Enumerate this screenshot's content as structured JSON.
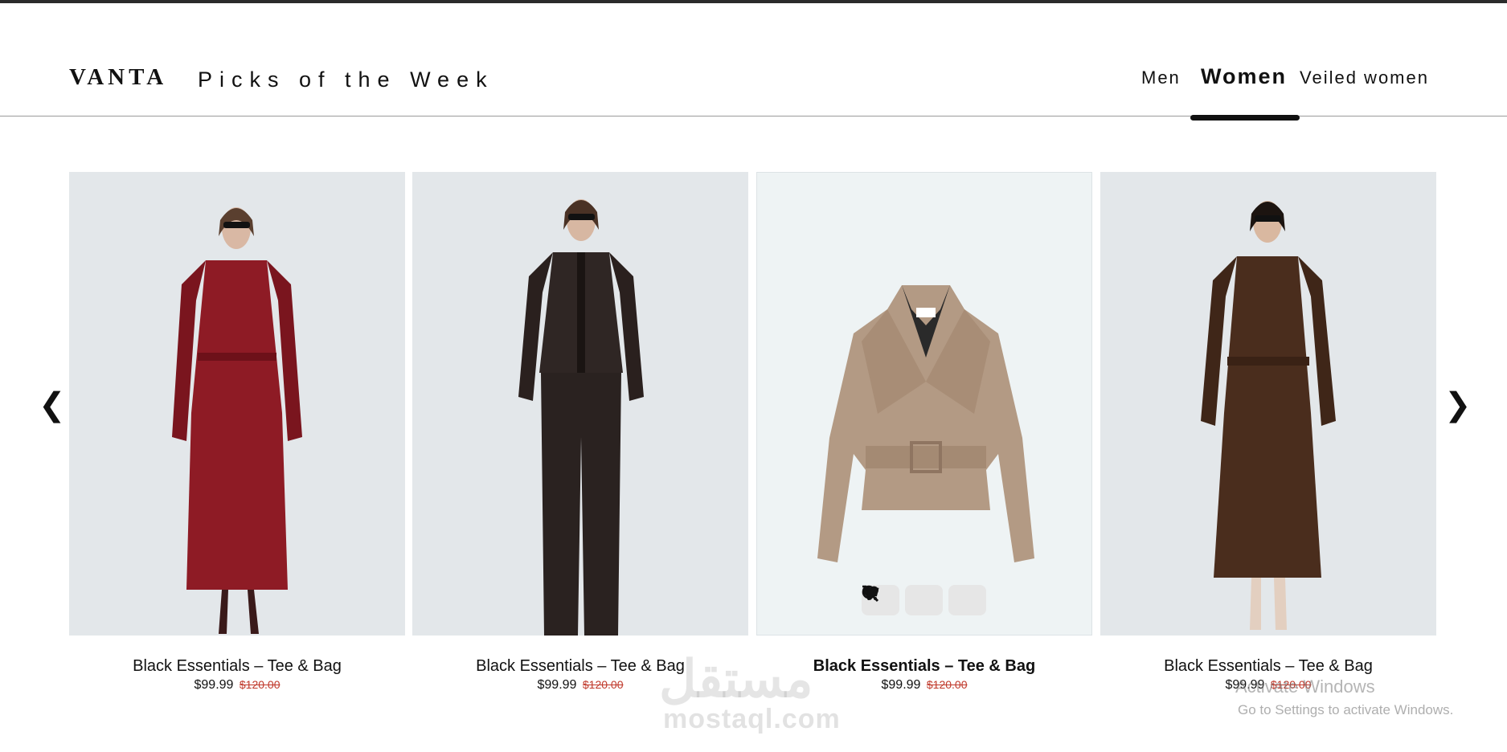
{
  "header": {
    "brand": "VANTA",
    "tagline": "Picks of the Week",
    "tabs": [
      {
        "label": "Men",
        "active": false
      },
      {
        "label": "Women",
        "active": true
      },
      {
        "label": "Veiled women",
        "active": false
      }
    ]
  },
  "carousel": {
    "prev_icon": "chevron-left-icon",
    "prev_label": "❮",
    "next_icon": "chevron-right-icon",
    "next_label": "❯",
    "products": [
      {
        "title": "Black Essentials – Tee & Bag",
        "price": "$99.99",
        "old_price": "$120.00",
        "image": "woman in red leather trench coat",
        "color": "#8e1b25"
      },
      {
        "title": "Black Essentials – Tee & Bag",
        "price": "$99.99",
        "old_price": "$120.00",
        "image": "woman in dark leather jacket and trousers",
        "color": "#2f2624"
      },
      {
        "title": "Black Essentials – Tee & Bag",
        "price": "$99.99",
        "old_price": "$120.00",
        "image": "beige leather cropped jacket",
        "color": "#b39a84"
      },
      {
        "title": "Black Essentials – Tee & Bag",
        "price": "$99.99",
        "old_price": "$120.00",
        "image": "woman in brown suede trench coat",
        "color": "#4a2d1d"
      }
    ],
    "hover_actions": [
      "cart-icon",
      "heart-icon",
      "zoom-in-icon"
    ]
  },
  "overlays": {
    "watermark_arabic": "مستقل",
    "watermark_url": "mostaql.com",
    "windows_activate": "Activate Windows",
    "windows_activate_sub": "Go to Settings to activate Windows."
  },
  "colors": {
    "accent": "#111111",
    "old_price": "#c0392b",
    "header_rule": "#9a9a9a"
  }
}
